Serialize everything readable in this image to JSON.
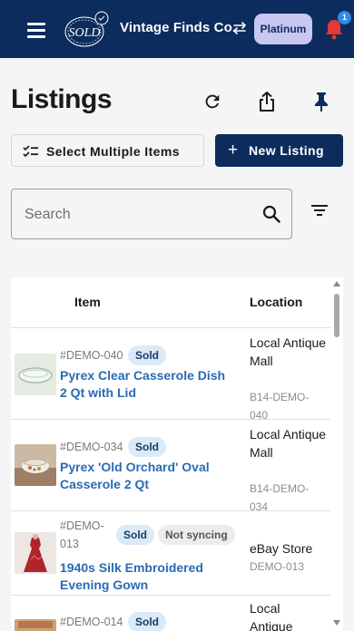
{
  "topbar": {
    "brand_name": "Vintage Finds Co.",
    "logo_text": "SOLD",
    "plan": "Platinum",
    "notification_count": "1",
    "colors": {
      "bar": "#0d2c5e",
      "plan_bg": "#c9c6f2",
      "bell": "#e53935",
      "badge": "#2f8be6"
    }
  },
  "page": {
    "title": "Listings",
    "select_multiple_label": "Select Multiple Items",
    "new_listing_label": "New Listing"
  },
  "search": {
    "placeholder": "Search",
    "value": ""
  },
  "table": {
    "headers": {
      "item": "Item",
      "location": "Location"
    },
    "rows": [
      {
        "sku": "#DEMO-040",
        "status": "Sold",
        "sync": "",
        "title": "Pyrex Clear Casserole Dish 2 Qt with Lid",
        "location": "Local Antique Mall",
        "location_code": "B14-DEMO-040"
      },
      {
        "sku": "#DEMO-034",
        "status": "Sold",
        "sync": "",
        "title": "Pyrex 'Old Orchard' Oval Casserole 2 Qt",
        "location": "Local Antique Mall",
        "location_code": "B14-DEMO-034"
      },
      {
        "sku": "#DEMO-013",
        "status": "Sold",
        "sync": "Not syncing",
        "title": "1940s Silk Embroidered Evening Gown",
        "location": "eBay Store",
        "location_code": "DEMO-013"
      },
      {
        "sku": "#DEMO-014",
        "status": "Sold",
        "sync": "",
        "title": "",
        "location": "Local Antique",
        "location_code": ""
      }
    ]
  }
}
